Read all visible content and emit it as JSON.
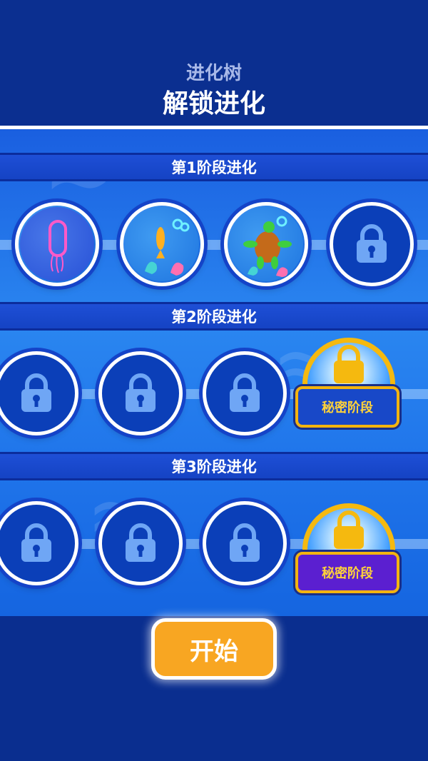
{
  "header": {
    "subtitle": "进化树",
    "title": "解锁进化"
  },
  "stages": [
    {
      "label": "第1阶段进化",
      "nodes": [
        "bacteria",
        "fish",
        "turtle",
        "locked"
      ]
    },
    {
      "label": "第2阶段进化",
      "nodes": [
        "locked",
        "locked",
        "locked"
      ],
      "secret_label": "秘密阶段",
      "secret_color": "#1848c8"
    },
    {
      "label": "第3阶段进化",
      "nodes": [
        "locked",
        "locked",
        "locked"
      ],
      "secret_label": "秘密阶段",
      "secret_color": "#5b1fd0"
    }
  ],
  "icons": {
    "lock": "lock-icon",
    "bacteria": "bacteria-icon",
    "fish": "fish-icon",
    "turtle": "turtle-icon"
  },
  "colors": {
    "background": "#0a2e8f",
    "accent": "#f8a622",
    "secret_gold": "#f5b90f"
  },
  "start_button": {
    "label": "开始"
  }
}
